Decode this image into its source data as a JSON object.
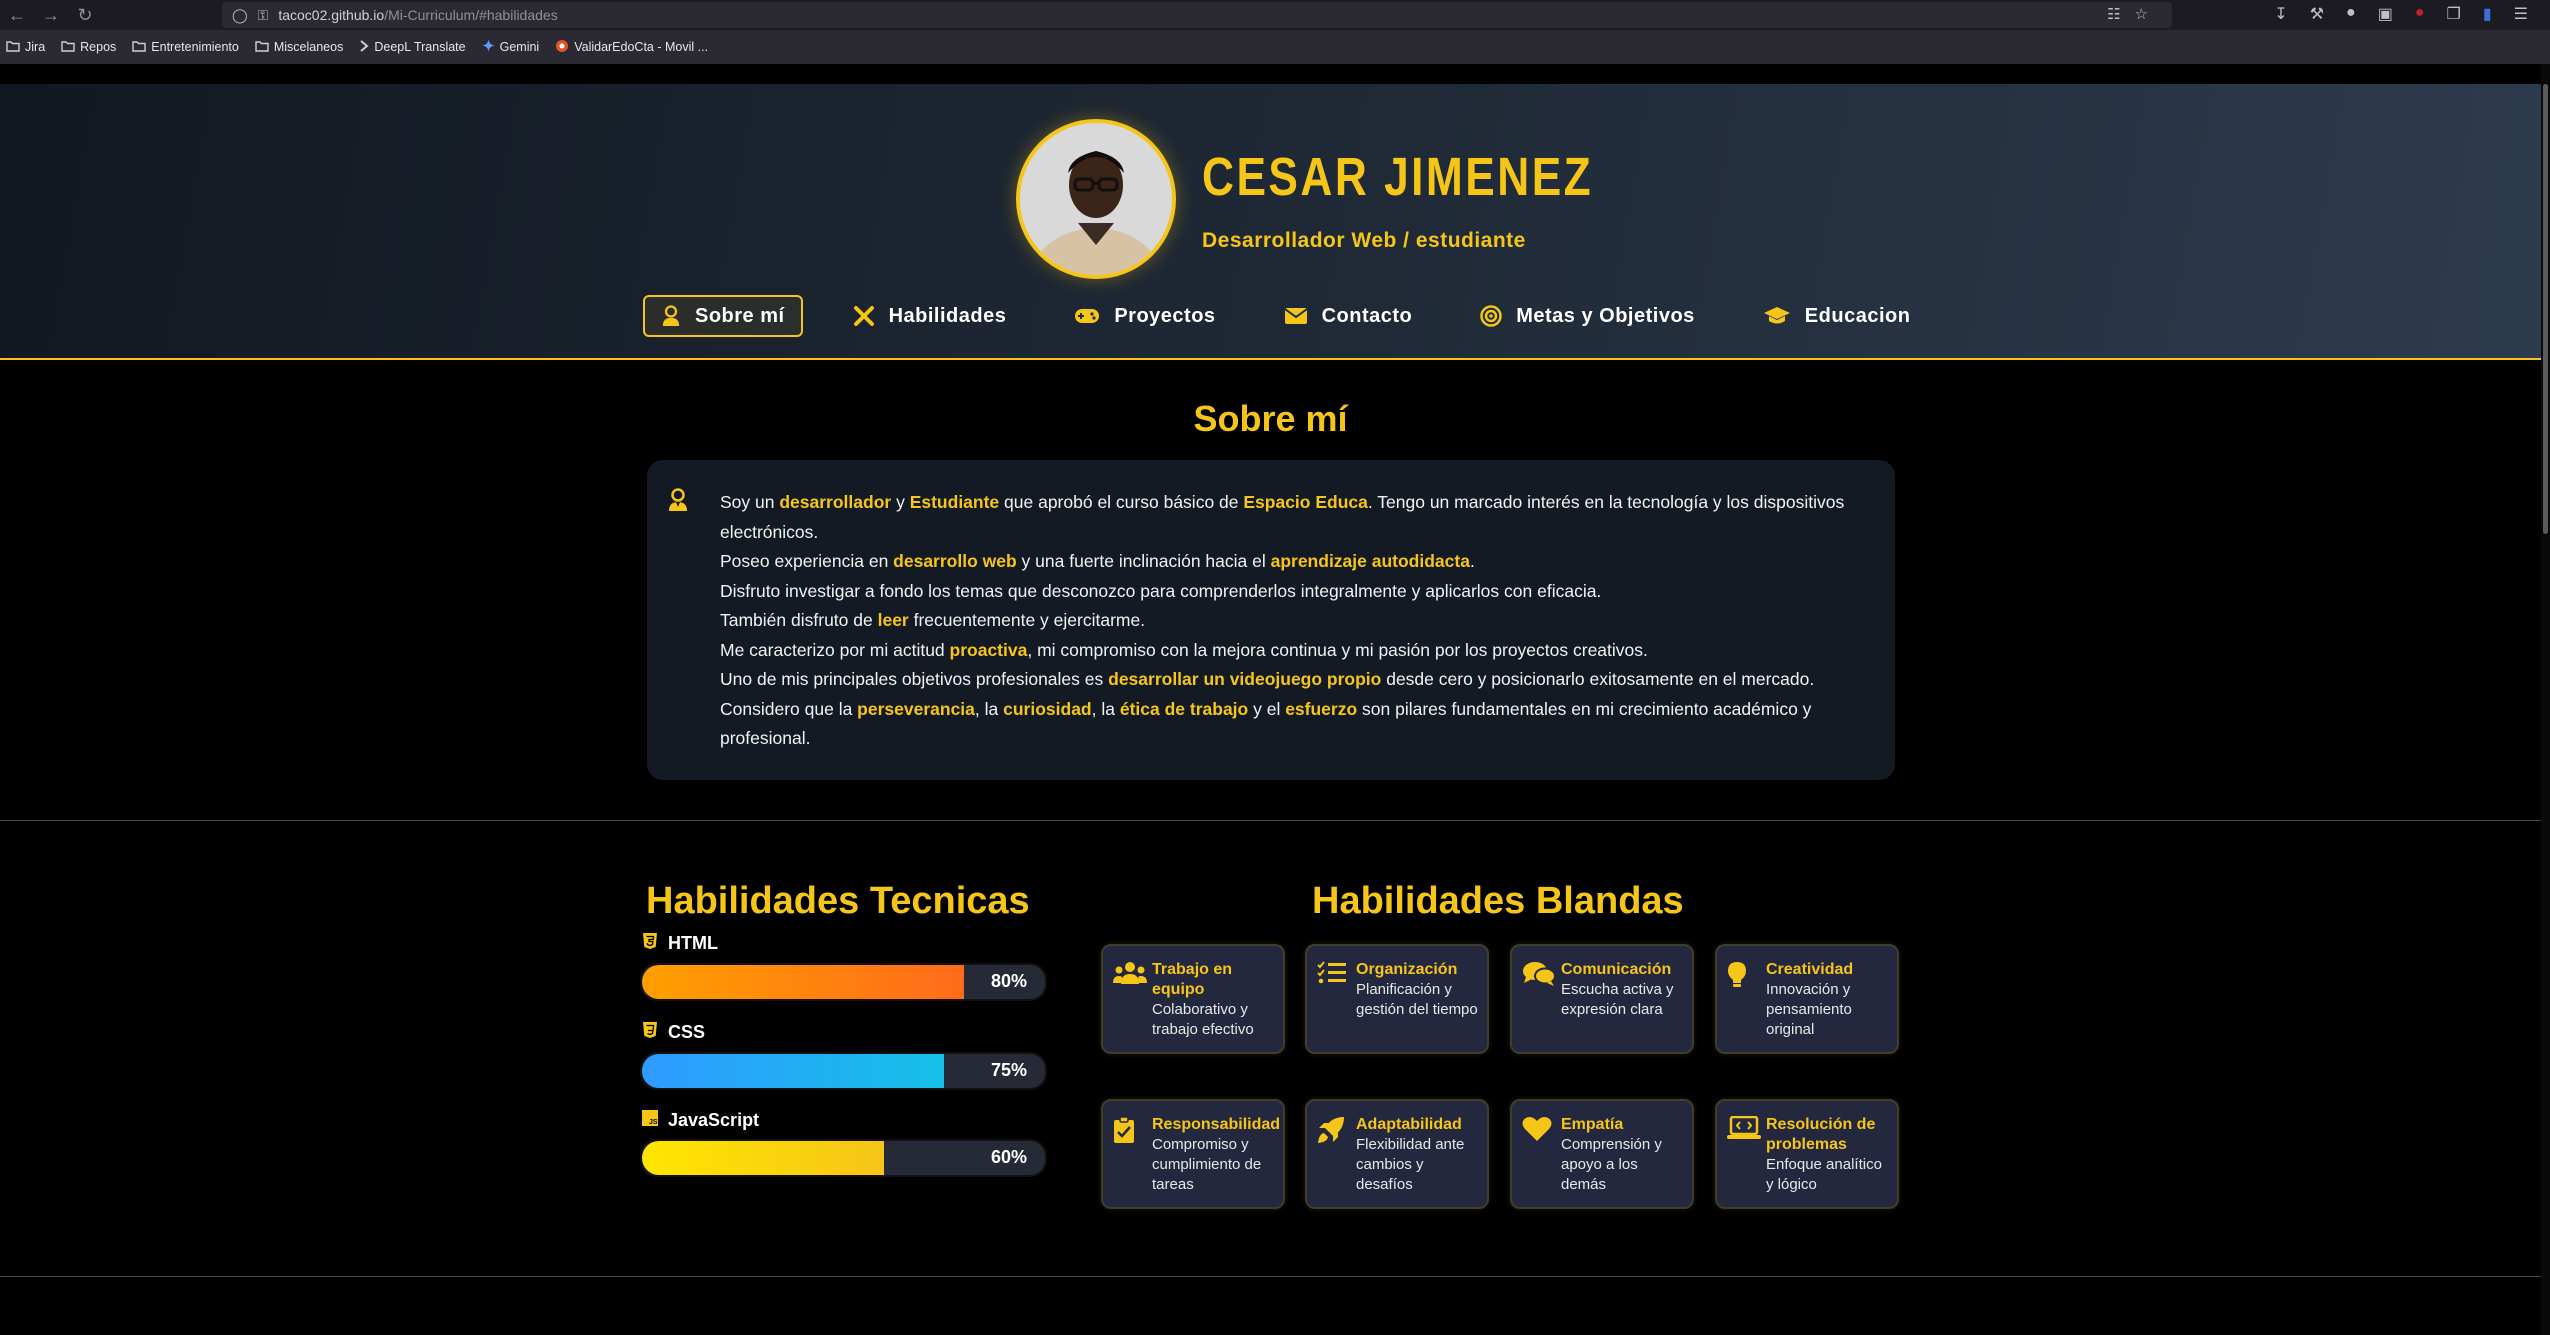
{
  "browser": {
    "url_domain": "tacoc02.github.io",
    "url_path": "/Mi-Curriculum/#habilidades",
    "bookmarks": [
      {
        "label": "Jira",
        "icon": "folder-icon"
      },
      {
        "label": "Repos",
        "icon": "folder-icon"
      },
      {
        "label": "Entretenimiento",
        "icon": "folder-icon"
      },
      {
        "label": "Miscelaneos",
        "icon": "folder-icon"
      },
      {
        "label": "DeepL Translate",
        "icon": "deepl-icon"
      },
      {
        "label": "Gemini",
        "icon": "gemini-icon"
      },
      {
        "label": "ValidarEdoCta - Movil ...",
        "icon": "site-icon"
      }
    ]
  },
  "header": {
    "name": "CESAR JIMENEZ",
    "role": "Desarrollador Web / estudiante",
    "accent_color": "#f5c518",
    "nav": [
      {
        "label": "Sobre mí",
        "icon": "user-tie-icon",
        "active": true
      },
      {
        "label": "Habilidades",
        "icon": "tools-icon",
        "active": false
      },
      {
        "label": "Proyectos",
        "icon": "gamepad-icon",
        "active": false
      },
      {
        "label": "Contacto",
        "icon": "envelope-icon",
        "active": false
      },
      {
        "label": "Metas y Objetivos",
        "icon": "bullseye-icon",
        "active": false
      },
      {
        "label": "Educacion",
        "icon": "graduation-cap-icon",
        "active": false
      }
    ]
  },
  "about": {
    "title": "Sobre mí",
    "paragraphs": [
      [
        {
          "t": "Soy un "
        },
        {
          "t": "desarrollador",
          "hl": true
        },
        {
          "t": " y "
        },
        {
          "t": "Estudiante",
          "hl": true
        },
        {
          "t": " que aprobó el curso básico de "
        },
        {
          "t": "Espacio Educa",
          "hl": true
        },
        {
          "t": ". Tengo un marcado interés en la tecnología y los dispositivos electrónicos."
        }
      ],
      [
        {
          "t": "Poseo experiencia en "
        },
        {
          "t": "desarrollo web",
          "hl": true
        },
        {
          "t": " y una fuerte inclinación hacia el "
        },
        {
          "t": "aprendizaje autodidacta",
          "hl": true
        },
        {
          "t": "."
        }
      ],
      [
        {
          "t": "Disfruto investigar a fondo los temas que desconozco para comprenderlos integralmente y aplicarlos con eficacia."
        }
      ],
      [
        {
          "t": "También disfruto de "
        },
        {
          "t": "leer",
          "hl": true
        },
        {
          "t": " frecuentemente y ejercitarme."
        }
      ],
      [
        {
          "t": "Me caracterizo por mi actitud "
        },
        {
          "t": "proactiva",
          "hl": true
        },
        {
          "t": ", mi compromiso con la mejora continua y mi pasión por los proyectos creativos."
        }
      ],
      [
        {
          "t": "Uno de mis principales objetivos profesionales es "
        },
        {
          "t": "desarrollar un videojuego propio",
          "hl": true
        },
        {
          "t": " desde cero y posicionarlo exitosamente en el mercado."
        }
      ],
      [
        {
          "t": "Considero que la "
        },
        {
          "t": "perseverancia",
          "hl": true
        },
        {
          "t": ", la "
        },
        {
          "t": "curiosidad",
          "hl": true
        },
        {
          "t": ", la "
        },
        {
          "t": "ética de trabajo",
          "hl": true
        },
        {
          "t": " y el "
        },
        {
          "t": "esfuerzo",
          "hl": true
        },
        {
          "t": " son pilares fundamentales en mi crecimiento académico y profesional."
        }
      ]
    ]
  },
  "tech_skills": {
    "title": "Habilidades Tecnicas",
    "items": [
      {
        "name": "HTML",
        "icon": "html5-icon",
        "percent": 80,
        "label": "80%",
        "colors": [
          "#ff9f00",
          "#ff6b1a"
        ]
      },
      {
        "name": "CSS",
        "icon": "css3-icon",
        "percent": 75,
        "label": "75%",
        "colors": [
          "#2e9bff",
          "#16c0e8"
        ]
      },
      {
        "name": "JavaScript",
        "icon": "js-icon",
        "percent": 60,
        "label": "60%",
        "colors": [
          "#ffe600",
          "#f5c518"
        ]
      }
    ]
  },
  "soft_skills": {
    "title": "Habilidades Blandas",
    "items": [
      {
        "name": "Trabajo en equipo",
        "desc": "Colaborativo y trabajo efectivo",
        "icon": "users-icon"
      },
      {
        "name": "Organización",
        "desc": "Planificación y gestión del tiempo",
        "icon": "list-check-icon"
      },
      {
        "name": "Comunicación",
        "desc": "Escucha activa y expresión clara",
        "icon": "comments-icon"
      },
      {
        "name": "Creatividad",
        "desc": "Innovación y pensamiento original",
        "icon": "lightbulb-icon"
      },
      {
        "name": "Responsabilidad",
        "desc": "Compromiso y cumplimiento de tareas",
        "icon": "clipboard-check-icon"
      },
      {
        "name": "Adaptabilidad",
        "desc": "Flexibilidad ante cambios y desafíos",
        "icon": "rocket-icon"
      },
      {
        "name": "Empatía",
        "desc": "Comprensión y apoyo a los demás",
        "icon": "heart-icon"
      },
      {
        "name": "Resolución de problemas",
        "desc": "Enfoque analítico y lógico",
        "icon": "laptop-code-icon"
      }
    ]
  }
}
